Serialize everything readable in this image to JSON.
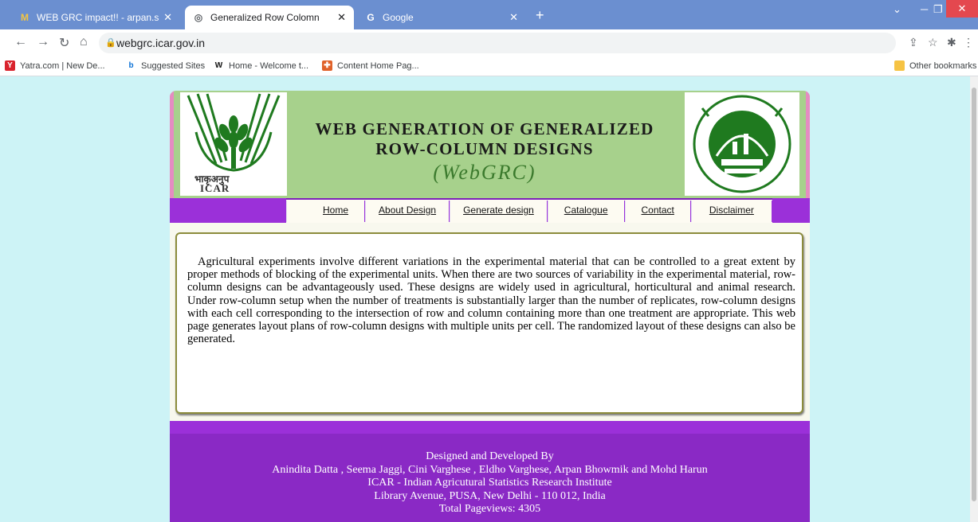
{
  "browser": {
    "tabs": [
      {
        "title": "WEB GRC impact!! - arpan.stat@",
        "favicon": "gmail-icon",
        "active": false
      },
      {
        "title": "Generalized Row Colomn",
        "favicon": "globe-icon",
        "active": true
      },
      {
        "title": "Google",
        "favicon": "google-icon",
        "active": false
      }
    ],
    "url": "webgrc.icar.gov.in",
    "bookmarks": [
      {
        "label": "Yatra.com | New De...",
        "icon": "yatra-icon",
        "color": "#d9232d"
      },
      {
        "label": "Suggested Sites",
        "icon": "bing-icon",
        "color": "#0d72d6"
      },
      {
        "label": "Home - Welcome t...",
        "icon": "w-icon",
        "color": "#111111"
      },
      {
        "label": "Content Home Pag...",
        "icon": "shield-icon",
        "color": "#e0622a"
      }
    ],
    "other_bookmarks": "Other bookmarks"
  },
  "banner": {
    "logo_left_hindi": "भाकृअनुप",
    "logo_left_text": "ICAR",
    "title_line1": "WEB GENERATION OF GENERALIZED",
    "title_line2": "ROW-COLUMN DESIGNS",
    "subtitle": "(WebGRC)"
  },
  "nav": {
    "items": [
      "Home",
      "About Design",
      "Generate design",
      "Catalogue",
      "Contact",
      "Disclaimer"
    ]
  },
  "content": {
    "paragraph": "Agricultural experiments involve different variations in the experimental material that can be  controlled to a great extent by proper methods of blocking of the experimental units. When there are two sources of variability in the experimental material, row-column designs can be advantageously used. These designs are widely used in agricultural, horticultural and animal research. Under row-column setup when the number of treatments is substantially larger than the number of replicates, row-column designs with each cell corresponding to the intersection of row and column containing more than one treatment are appropriate. This web page generates layout plans of row-column designs with multiple units per cell. The randomized layout of these designs can also be generated."
  },
  "footer": {
    "line1": "Designed and Developed By",
    "line2": "Anindita Datta , Seema Jaggi, Cini Varghese , Eldho Varghese, Arpan Bhowmik and Mohd Harun",
    "line3": "ICAR - Indian Agricutural Statistics Research Institute",
    "line4": "Library Avenue, PUSA, New Delhi - 110 012, India",
    "line5": "Total Pageviews: 4305"
  },
  "colors": {
    "page_bg": "#cdf3f6",
    "banner_bg": "#a7d18c",
    "nav_purple": "#9b30d9",
    "footer_purple": "#8a29c5",
    "subtitle_green": "#3b7a2d"
  }
}
